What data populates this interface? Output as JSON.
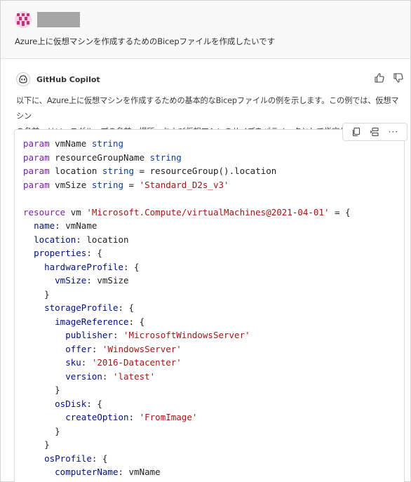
{
  "user": {
    "message": "Azure上に仮想マシンを作成するためのBicepファイルを作成したいです"
  },
  "assistant": {
    "name": "GitHub Copilot",
    "intro_line1": "以下に、Azure上に仮想マシンを作成するための基本的なBicepファイルの例を示します。この例では、仮想マシン",
    "intro_line2": "の名前、リソースグループの名前、場所、および仮想マシンのサイズをパラメータとして指定します。"
  },
  "code_toolbar": {
    "icons": [
      "copy-icon",
      "insert-icon",
      "more-icon"
    ],
    "more_label": "···"
  },
  "code_lines": [
    [
      [
        "kw",
        "param"
      ],
      [
        "pun",
        " "
      ],
      [
        "pun",
        "vmName"
      ],
      [
        "pun",
        " "
      ],
      [
        "ty",
        "string"
      ]
    ],
    [
      [
        "kw",
        "param"
      ],
      [
        "pun",
        " "
      ],
      [
        "pun",
        "resourceGroupName"
      ],
      [
        "pun",
        " "
      ],
      [
        "ty",
        "string"
      ]
    ],
    [
      [
        "kw",
        "param"
      ],
      [
        "pun",
        " "
      ],
      [
        "pun",
        "location"
      ],
      [
        "pun",
        " "
      ],
      [
        "ty",
        "string"
      ],
      [
        "pun",
        " = "
      ],
      [
        "pun",
        "resourceGroup"
      ],
      [
        "pun",
        "()"
      ],
      [
        "pun",
        ".location"
      ]
    ],
    [
      [
        "kw",
        "param"
      ],
      [
        "pun",
        " "
      ],
      [
        "pun",
        "vmSize"
      ],
      [
        "pun",
        " "
      ],
      [
        "ty",
        "string"
      ],
      [
        "pun",
        " = "
      ],
      [
        "str",
        "'Standard_D2s_v3'"
      ]
    ],
    [],
    [
      [
        "kw",
        "resource"
      ],
      [
        "pun",
        " vm "
      ],
      [
        "str",
        "'Microsoft.Compute/virtualMachines@2021-04-01'"
      ],
      [
        "pun",
        " = {"
      ]
    ],
    [
      [
        "pun",
        "  "
      ],
      [
        "prop",
        "name"
      ],
      [
        "pun",
        ": vmName"
      ]
    ],
    [
      [
        "pun",
        "  "
      ],
      [
        "prop",
        "location"
      ],
      [
        "pun",
        ": location"
      ]
    ],
    [
      [
        "pun",
        "  "
      ],
      [
        "prop",
        "properties"
      ],
      [
        "pun",
        ": {"
      ]
    ],
    [
      [
        "pun",
        "    "
      ],
      [
        "prop",
        "hardwareProfile"
      ],
      [
        "pun",
        ": {"
      ]
    ],
    [
      [
        "pun",
        "      "
      ],
      [
        "prop",
        "vmSize"
      ],
      [
        "pun",
        ": vmSize"
      ]
    ],
    [
      [
        "pun",
        "    }"
      ]
    ],
    [
      [
        "pun",
        "    "
      ],
      [
        "prop",
        "storageProfile"
      ],
      [
        "pun",
        ": {"
      ]
    ],
    [
      [
        "pun",
        "      "
      ],
      [
        "prop",
        "imageReference"
      ],
      [
        "pun",
        ": {"
      ]
    ],
    [
      [
        "pun",
        "        "
      ],
      [
        "prop",
        "publisher"
      ],
      [
        "pun",
        ": "
      ],
      [
        "str",
        "'MicrosoftWindowsServer'"
      ]
    ],
    [
      [
        "pun",
        "        "
      ],
      [
        "prop",
        "offer"
      ],
      [
        "pun",
        ": "
      ],
      [
        "str",
        "'WindowsServer'"
      ]
    ],
    [
      [
        "pun",
        "        "
      ],
      [
        "prop",
        "sku"
      ],
      [
        "pun",
        ": "
      ],
      [
        "str",
        "'2016-Datacenter'"
      ]
    ],
    [
      [
        "pun",
        "        "
      ],
      [
        "prop",
        "version"
      ],
      [
        "pun",
        ": "
      ],
      [
        "str",
        "'latest'"
      ]
    ],
    [
      [
        "pun",
        "      }"
      ]
    ],
    [
      [
        "pun",
        "      "
      ],
      [
        "prop",
        "osDisk"
      ],
      [
        "pun",
        ": {"
      ]
    ],
    [
      [
        "pun",
        "        "
      ],
      [
        "prop",
        "createOption"
      ],
      [
        "pun",
        ": "
      ],
      [
        "str",
        "'FromImage'"
      ]
    ],
    [
      [
        "pun",
        "      }"
      ]
    ],
    [
      [
        "pun",
        "    }"
      ]
    ],
    [
      [
        "pun",
        "    "
      ],
      [
        "prop",
        "osProfile"
      ],
      [
        "pun",
        ": {"
      ]
    ],
    [
      [
        "pun",
        "      "
      ],
      [
        "prop",
        "computerName"
      ],
      [
        "pun",
        ": vmName"
      ]
    ]
  ],
  "colors": {
    "keyword": "#7a1fa8",
    "type": "#0b3f99",
    "string": "#a31515",
    "property": "#001080",
    "user_block_bg": "#f8f8f8",
    "avatar_pink": "#c2337a"
  }
}
